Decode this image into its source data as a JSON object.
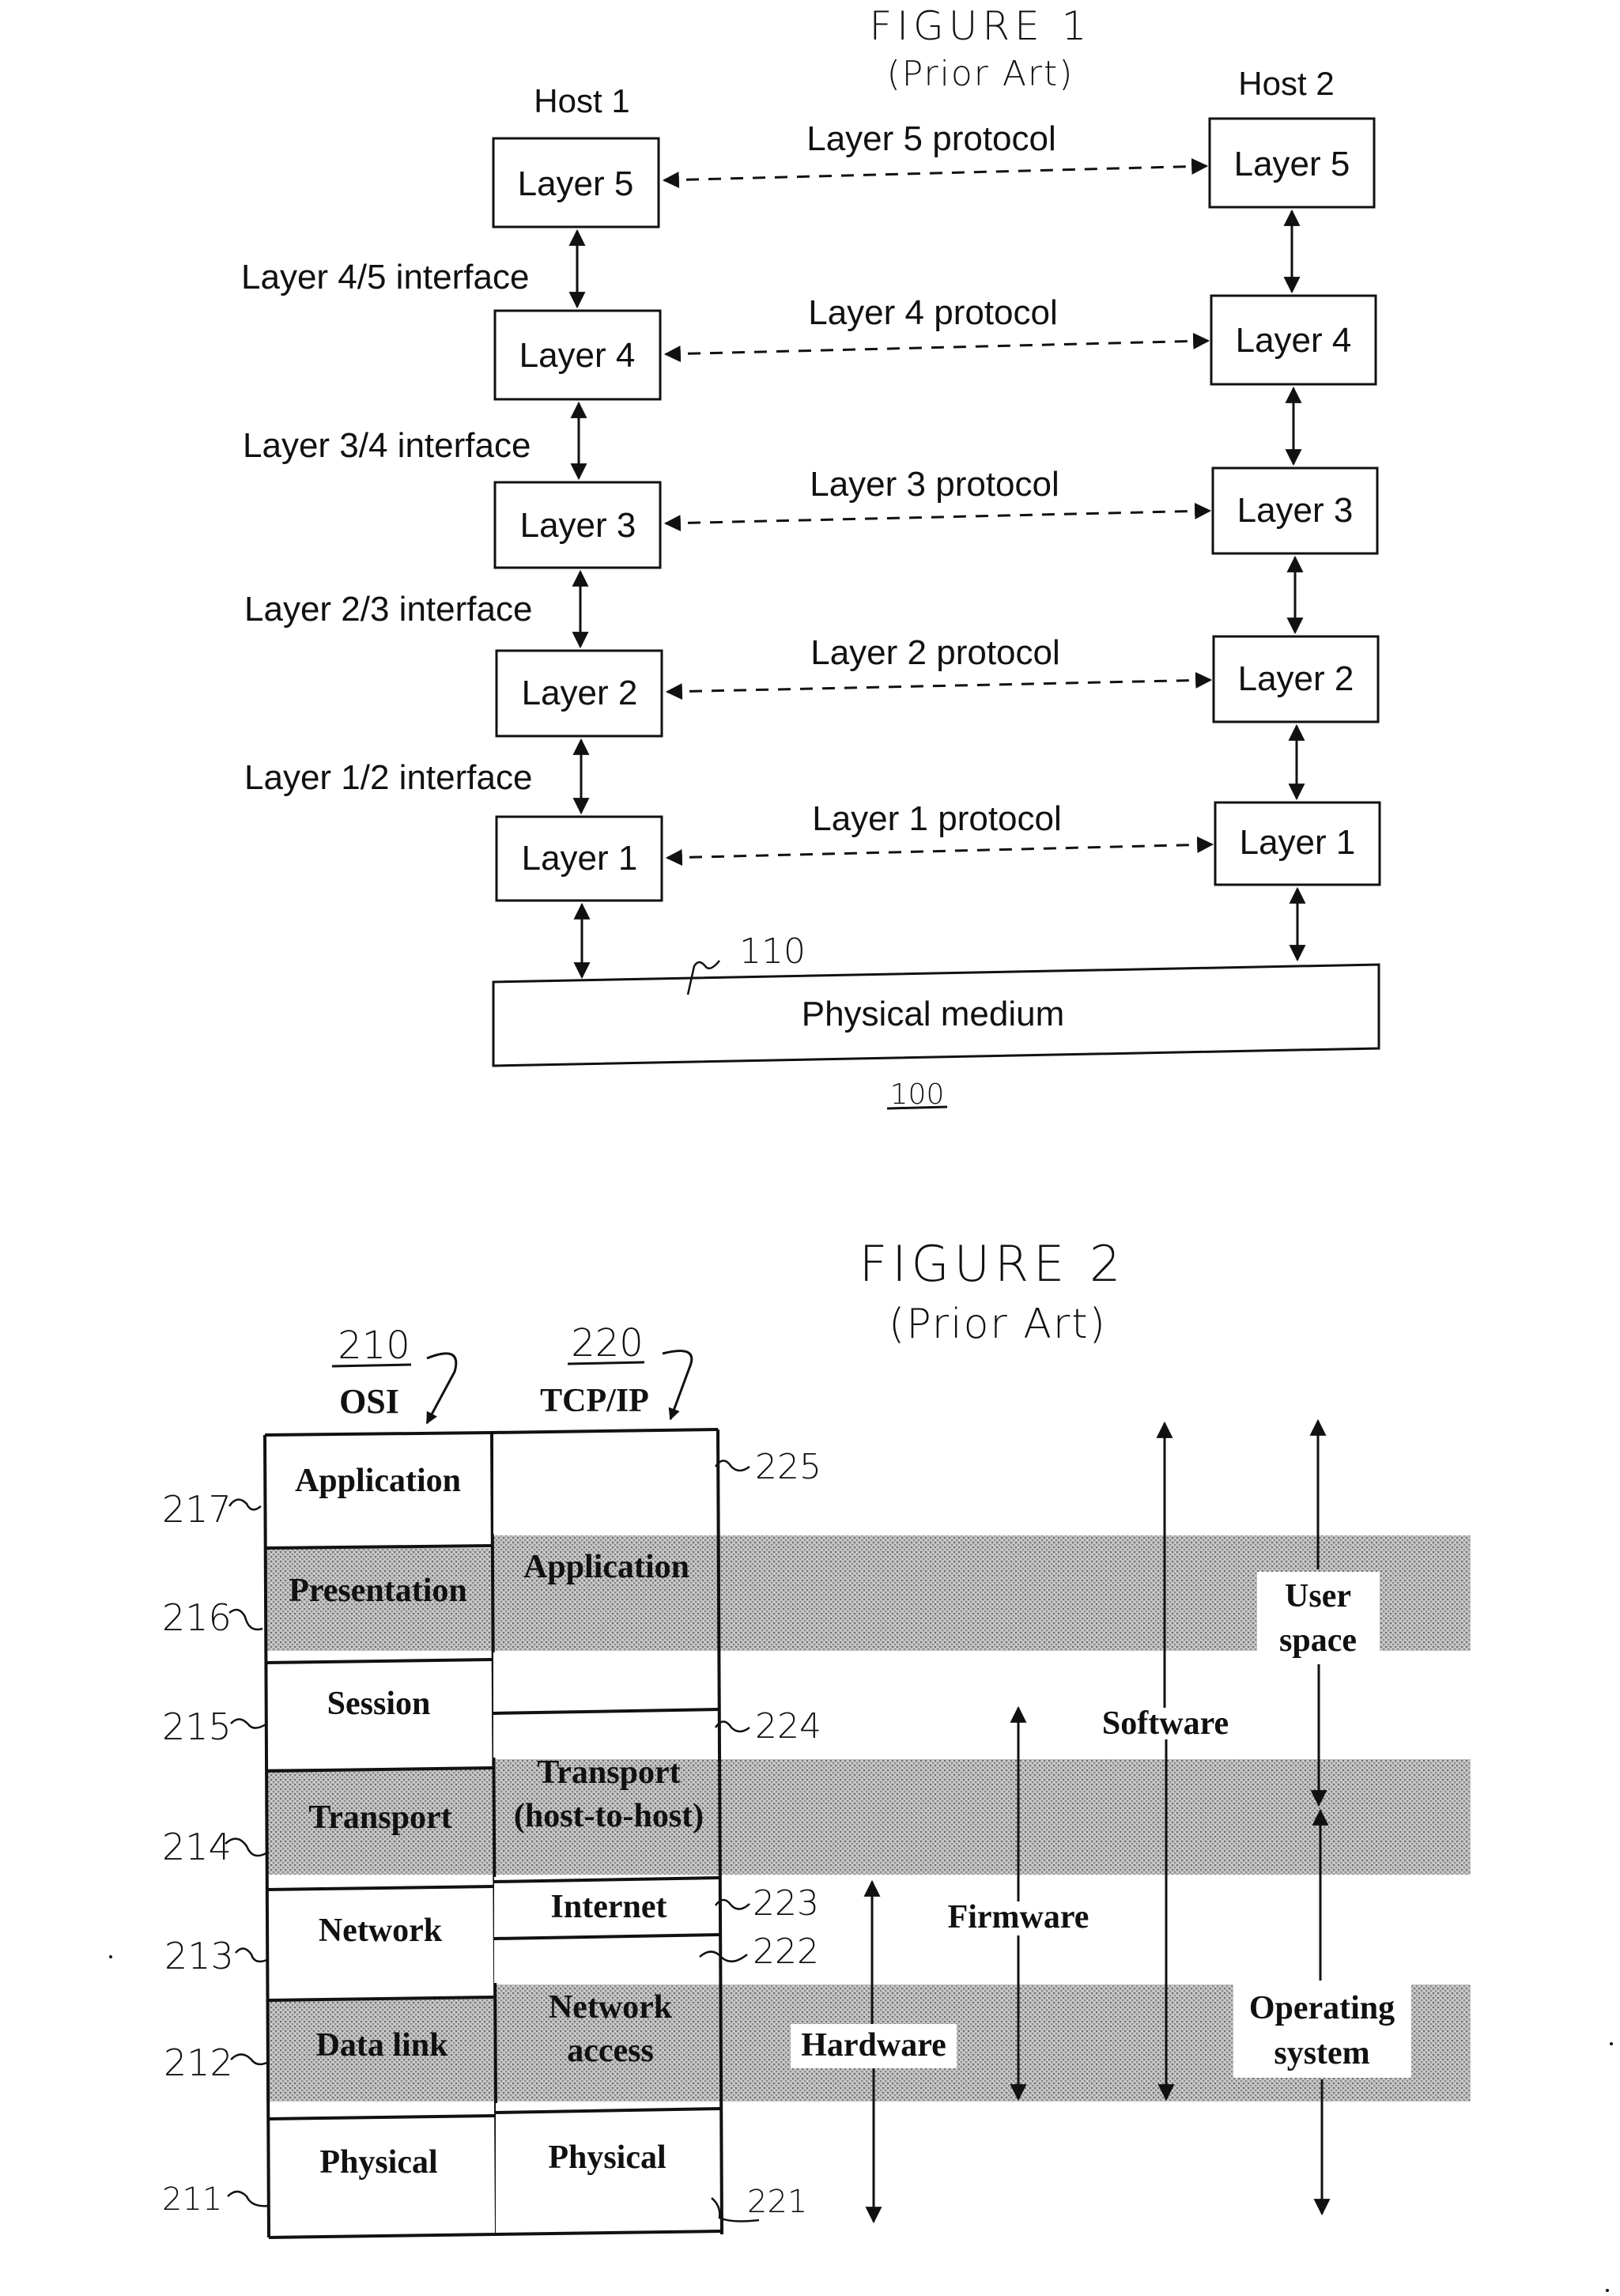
{
  "figure1": {
    "title": "FIGURE 1",
    "subtitle": "(Prior Art)",
    "host1_label": "Host 1",
    "host2_label": "Host 2",
    "layers": [
      {
        "host1": "Layer 5",
        "host2": "Layer 5",
        "protocol": "Layer 5 protocol"
      },
      {
        "host1": "Layer 4",
        "host2": "Layer 4",
        "protocol": "Layer 4 protocol"
      },
      {
        "host1": "Layer 3",
        "host2": "Layer 3",
        "protocol": "Layer 3 protocol"
      },
      {
        "host1": "Layer 2",
        "host2": "Layer 2",
        "protocol": "Layer 2 protocol"
      },
      {
        "host1": "Layer 1",
        "host2": "Layer 1",
        "protocol": "Layer 1 protocol"
      }
    ],
    "interfaces": [
      "Layer 4/5 interface",
      "Layer 3/4 interface",
      "Layer 2/3 interface",
      "Layer 1/2 interface"
    ],
    "physical_medium": "Physical medium",
    "ref_medium": "110",
    "ref_figure": "100"
  },
  "figure2": {
    "title": "FIGURE 2",
    "subtitle": "(Prior Art)",
    "osi": {
      "ref": "210",
      "header": "OSI",
      "rows": [
        {
          "label": "Application",
          "ref": "217"
        },
        {
          "label": "Presentation",
          "ref": "216"
        },
        {
          "label": "Session",
          "ref": "215"
        },
        {
          "label": "Transport",
          "ref": "214"
        },
        {
          "label": "Network",
          "ref": "213"
        },
        {
          "label": "Data link",
          "ref": "212"
        },
        {
          "label": "Physical",
          "ref": "211"
        }
      ]
    },
    "tcpip": {
      "ref": "220",
      "header": "TCP/IP",
      "rows": [
        {
          "label": "Application",
          "ref": "225"
        },
        {
          "label": "Transport\n(host-to-host)",
          "line1": "Transport",
          "line2": "(host-to-host)",
          "ref": "224"
        },
        {
          "label": "Internet",
          "ref": "223"
        },
        {
          "label": "Network access",
          "line1": "Network",
          "line2": "access",
          "ref": "222"
        },
        {
          "label": "Physical",
          "ref": "221"
        }
      ]
    },
    "spans": [
      {
        "label": "Hardware"
      },
      {
        "label": "Firmware"
      },
      {
        "label": "Software"
      },
      {
        "label": "User space",
        "line1": "User",
        "line2": "space"
      },
      {
        "label": "Operating system",
        "line1": "Operating",
        "line2": "system"
      }
    ]
  }
}
